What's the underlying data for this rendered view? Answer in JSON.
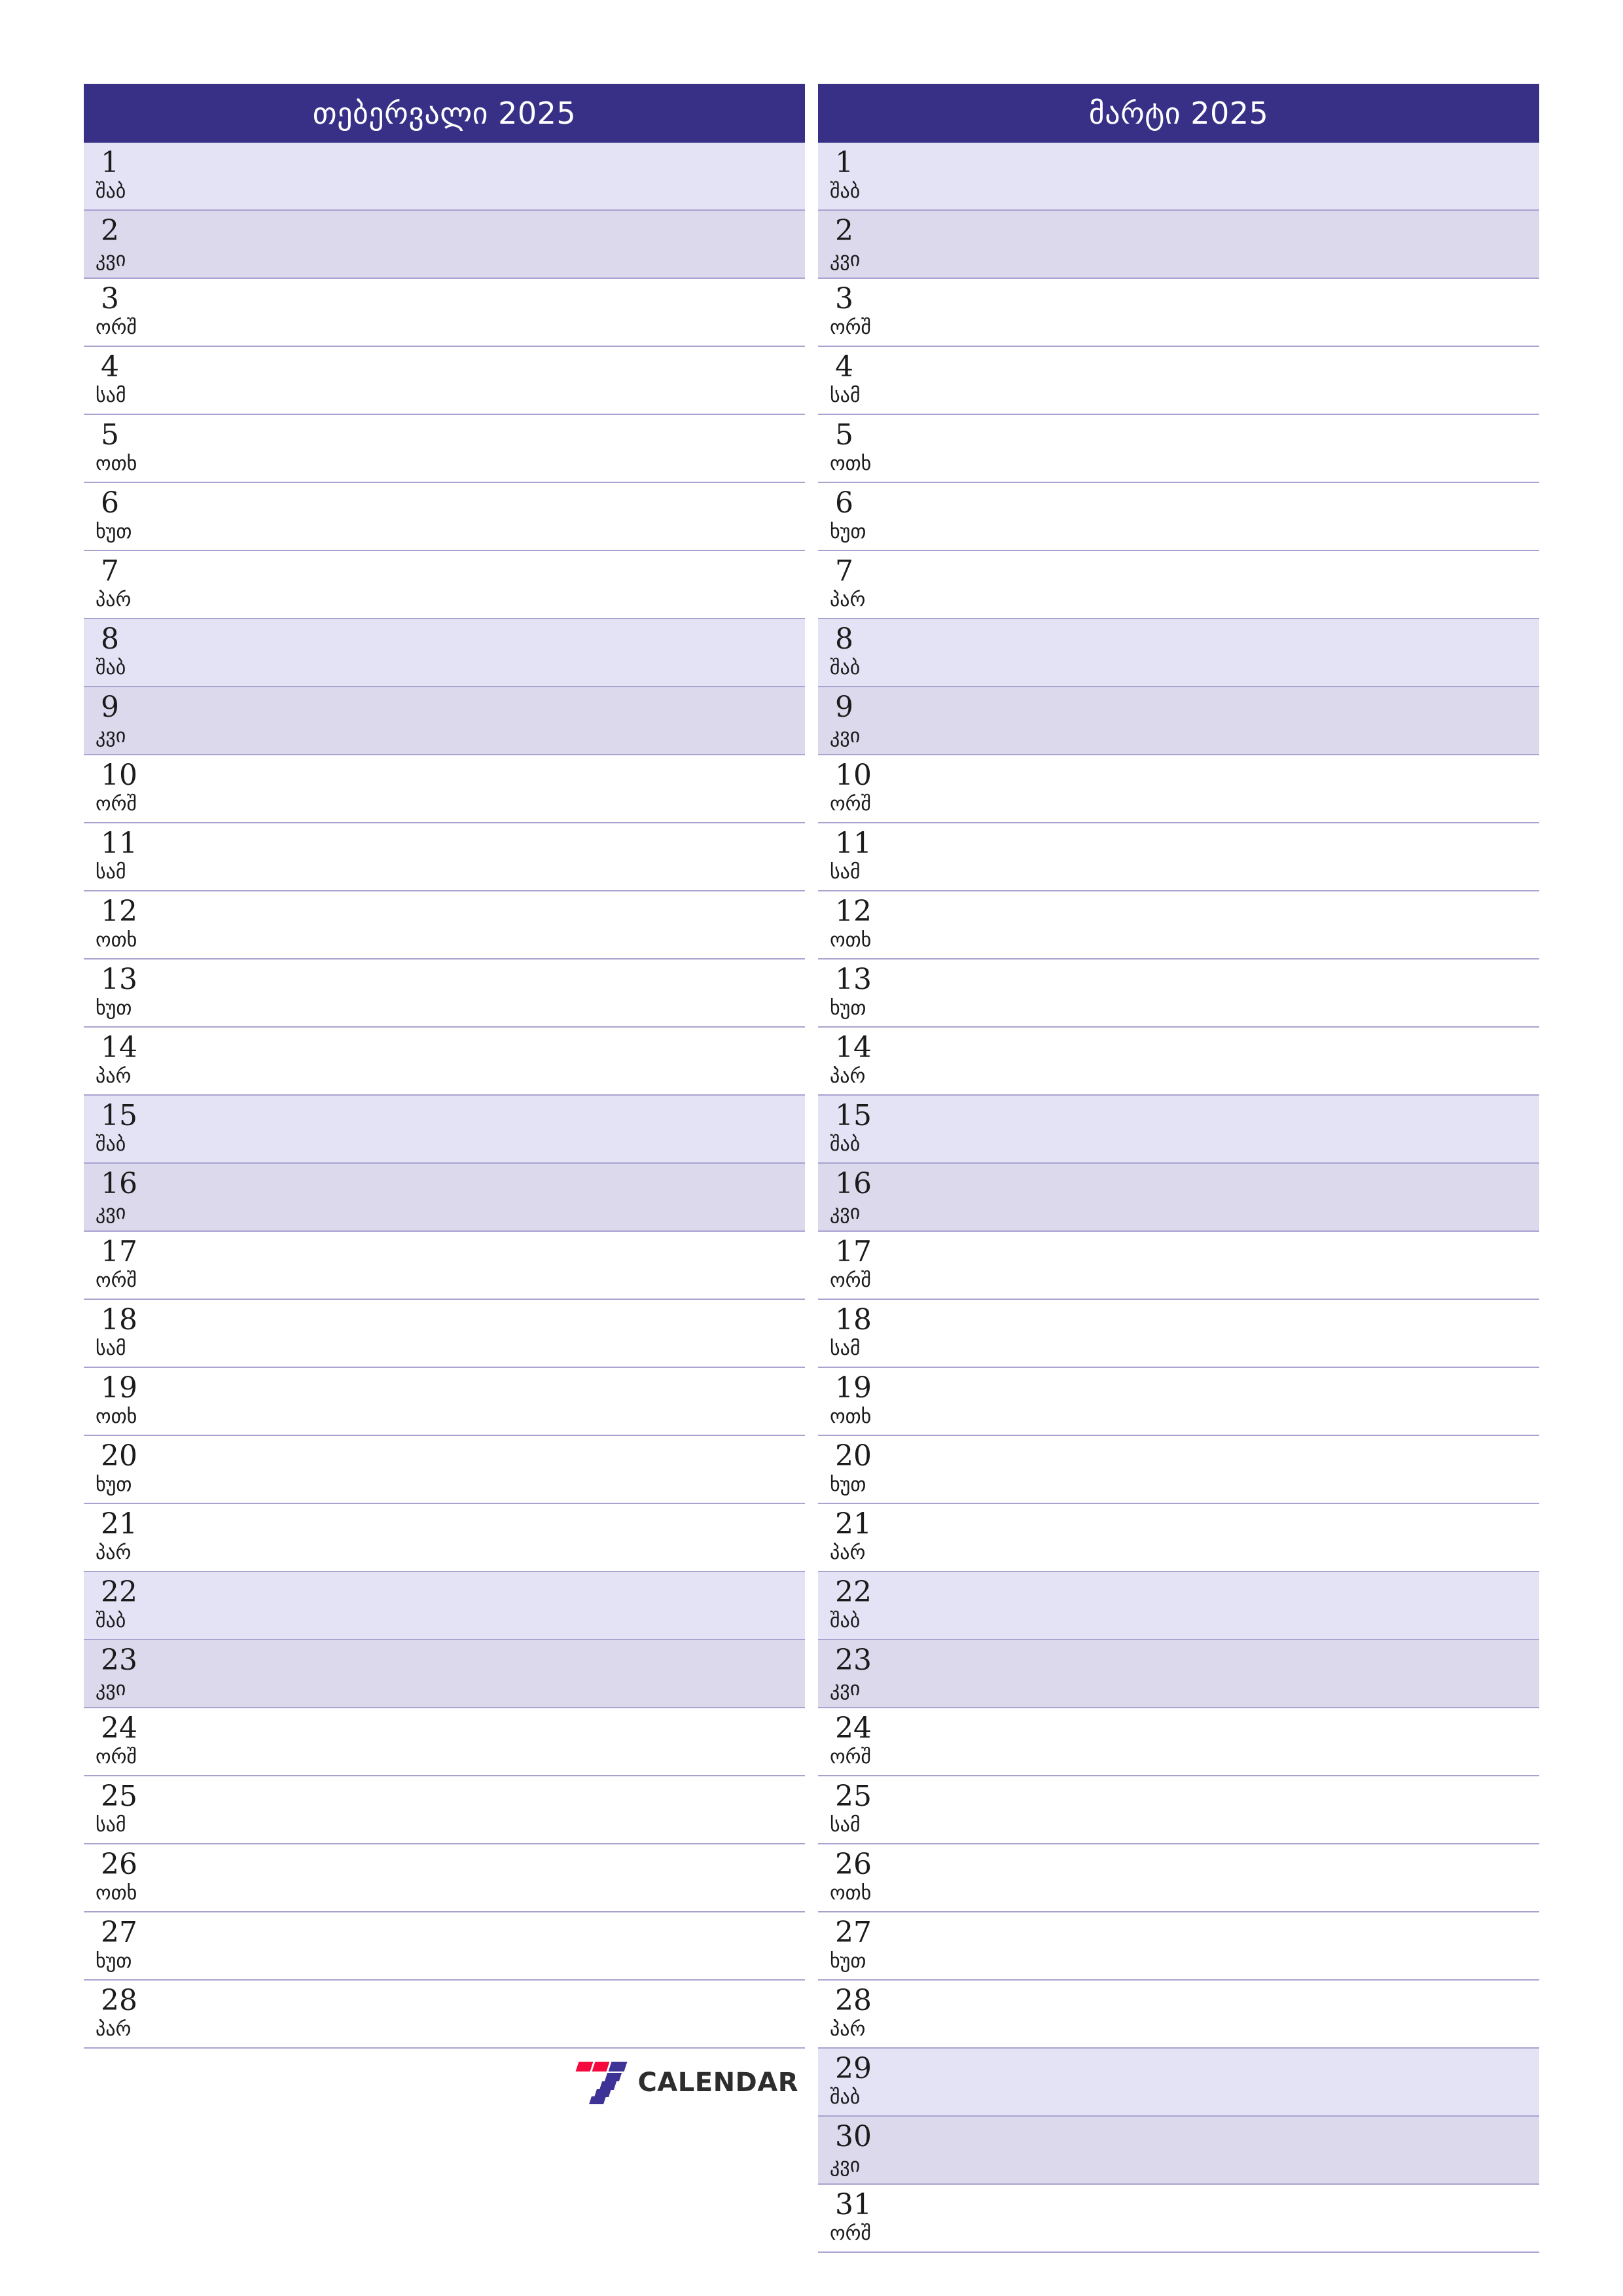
{
  "colors": {
    "header_bg": "#383087",
    "header_text": "#ffffff",
    "saturday_bg": "#e4e3f6",
    "sunday_bg": "#dcd9ec",
    "row_line": "#a9a3d0",
    "logo_red": "#f5093c",
    "logo_purple": "#3f3296",
    "logo_text": "#2d2d2d",
    "page_bg": "#ffffff"
  },
  "logo": {
    "name": "7calendar-logo",
    "mark": "seven-stripes-icon",
    "text": "CALENDAR"
  },
  "weekday_names": {
    "mon": "ორშ",
    "tue": "სამ",
    "wed": "ოთხ",
    "thu": "ხუთ",
    "fri": "პარ",
    "sat": "შაბ",
    "sun": "კვი"
  },
  "months": [
    {
      "id": "february-2025",
      "title": "თებერვალი 2025",
      "days": [
        {
          "n": "1",
          "wd": "შაბ",
          "type": "sat"
        },
        {
          "n": "2",
          "wd": "კვი",
          "type": "sun"
        },
        {
          "n": "3",
          "wd": "ორშ",
          "type": "wd"
        },
        {
          "n": "4",
          "wd": "სამ",
          "type": "wd"
        },
        {
          "n": "5",
          "wd": "ოთხ",
          "type": "wd"
        },
        {
          "n": "6",
          "wd": "ხუთ",
          "type": "wd"
        },
        {
          "n": "7",
          "wd": "პარ",
          "type": "wd"
        },
        {
          "n": "8",
          "wd": "შაბ",
          "type": "sat"
        },
        {
          "n": "9",
          "wd": "კვი",
          "type": "sun"
        },
        {
          "n": "10",
          "wd": "ორშ",
          "type": "wd"
        },
        {
          "n": "11",
          "wd": "სამ",
          "type": "wd"
        },
        {
          "n": "12",
          "wd": "ოთხ",
          "type": "wd"
        },
        {
          "n": "13",
          "wd": "ხუთ",
          "type": "wd"
        },
        {
          "n": "14",
          "wd": "პარ",
          "type": "wd"
        },
        {
          "n": "15",
          "wd": "შაბ",
          "type": "sat"
        },
        {
          "n": "16",
          "wd": "კვი",
          "type": "sun"
        },
        {
          "n": "17",
          "wd": "ორშ",
          "type": "wd"
        },
        {
          "n": "18",
          "wd": "სამ",
          "type": "wd"
        },
        {
          "n": "19",
          "wd": "ოთხ",
          "type": "wd"
        },
        {
          "n": "20",
          "wd": "ხუთ",
          "type": "wd"
        },
        {
          "n": "21",
          "wd": "პარ",
          "type": "wd"
        },
        {
          "n": "22",
          "wd": "შაბ",
          "type": "sat"
        },
        {
          "n": "23",
          "wd": "კვი",
          "type": "sun"
        },
        {
          "n": "24",
          "wd": "ორშ",
          "type": "wd"
        },
        {
          "n": "25",
          "wd": "სამ",
          "type": "wd"
        },
        {
          "n": "26",
          "wd": "ოთხ",
          "type": "wd"
        },
        {
          "n": "27",
          "wd": "ხუთ",
          "type": "wd"
        },
        {
          "n": "28",
          "wd": "პარ",
          "type": "wd"
        }
      ]
    },
    {
      "id": "march-2025",
      "title": "მარტი 2025",
      "days": [
        {
          "n": "1",
          "wd": "შაბ",
          "type": "sat"
        },
        {
          "n": "2",
          "wd": "კვი",
          "type": "sun"
        },
        {
          "n": "3",
          "wd": "ორშ",
          "type": "wd"
        },
        {
          "n": "4",
          "wd": "სამ",
          "type": "wd"
        },
        {
          "n": "5",
          "wd": "ოთხ",
          "type": "wd"
        },
        {
          "n": "6",
          "wd": "ხუთ",
          "type": "wd"
        },
        {
          "n": "7",
          "wd": "პარ",
          "type": "wd"
        },
        {
          "n": "8",
          "wd": "შაბ",
          "type": "sat"
        },
        {
          "n": "9",
          "wd": "კვი",
          "type": "sun"
        },
        {
          "n": "10",
          "wd": "ორშ",
          "type": "wd"
        },
        {
          "n": "11",
          "wd": "სამ",
          "type": "wd"
        },
        {
          "n": "12",
          "wd": "ოთხ",
          "type": "wd"
        },
        {
          "n": "13",
          "wd": "ხუთ",
          "type": "wd"
        },
        {
          "n": "14",
          "wd": "პარ",
          "type": "wd"
        },
        {
          "n": "15",
          "wd": "შაბ",
          "type": "sat"
        },
        {
          "n": "16",
          "wd": "კვი",
          "type": "sun"
        },
        {
          "n": "17",
          "wd": "ორშ",
          "type": "wd"
        },
        {
          "n": "18",
          "wd": "სამ",
          "type": "wd"
        },
        {
          "n": "19",
          "wd": "ოთხ",
          "type": "wd"
        },
        {
          "n": "20",
          "wd": "ხუთ",
          "type": "wd"
        },
        {
          "n": "21",
          "wd": "პარ",
          "type": "wd"
        },
        {
          "n": "22",
          "wd": "შაბ",
          "type": "sat"
        },
        {
          "n": "23",
          "wd": "კვი",
          "type": "sun"
        },
        {
          "n": "24",
          "wd": "ორშ",
          "type": "wd"
        },
        {
          "n": "25",
          "wd": "სამ",
          "type": "wd"
        },
        {
          "n": "26",
          "wd": "ოთხ",
          "type": "wd"
        },
        {
          "n": "27",
          "wd": "ხუთ",
          "type": "wd"
        },
        {
          "n": "28",
          "wd": "პარ",
          "type": "wd"
        },
        {
          "n": "29",
          "wd": "შაბ",
          "type": "sat"
        },
        {
          "n": "30",
          "wd": "კვი",
          "type": "sun"
        },
        {
          "n": "31",
          "wd": "ორშ",
          "type": "wd"
        }
      ]
    }
  ]
}
